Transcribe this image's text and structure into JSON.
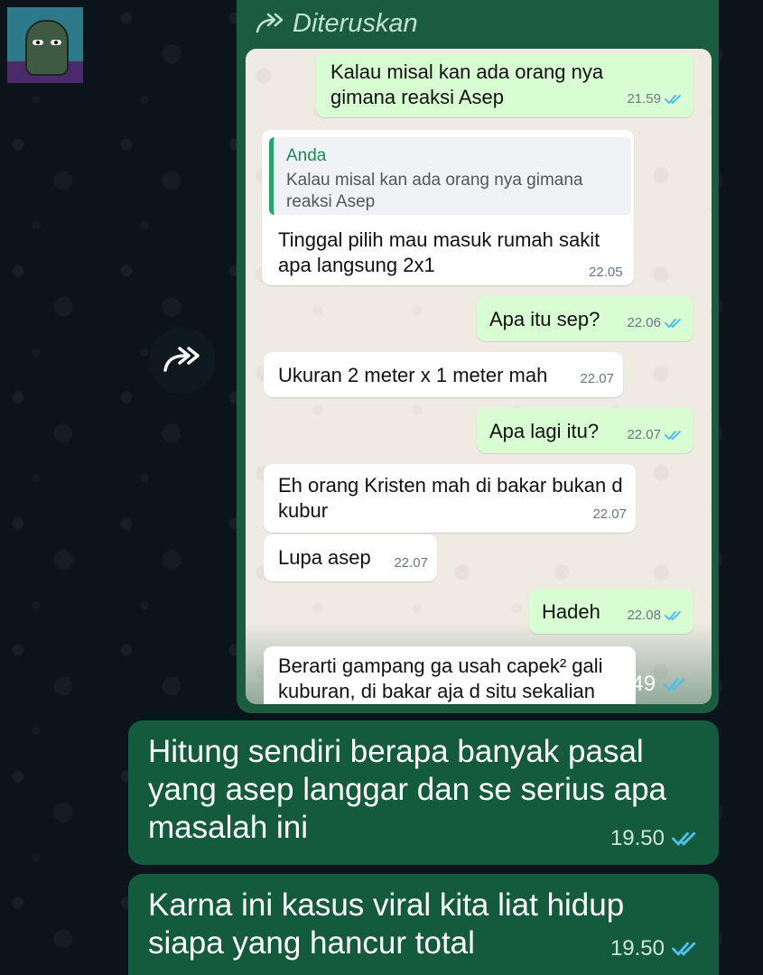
{
  "forward_label": "Diteruskan",
  "screenshot": {
    "messages": [
      {
        "text": "Kalau misal kan ada orang nya gimana reaksi Asep",
        "time": "21.59"
      },
      {
        "quote_author": "Anda",
        "quote_text": "Kalau misal kan ada orang nya gimana reaksi Asep",
        "text": "Tinggal pilih mau masuk rumah sakit apa langsung 2x1",
        "time": "22.05"
      },
      {
        "text": "Apa itu sep?",
        "time": "22.06"
      },
      {
        "text": "Ukuran 2 meter x 1 meter mah",
        "time": "22.07"
      },
      {
        "text": "Apa lagi itu?",
        "time": "22.07"
      },
      {
        "text": "Eh orang Kristen mah di bakar bukan d kubur",
        "time": "22.07"
      },
      {
        "text": "Lupa asep",
        "time": "22.07"
      },
      {
        "text": "Hadeh",
        "time": "22.08"
      },
      {
        "text": "Berarti gampang ga usah capek² gali kuburan, di bakar aja d situ sekalian",
        "time": ""
      }
    ],
    "forward_time": "19.49"
  },
  "messages": [
    {
      "text": "Hitung sendiri berapa banyak pasal yang asep langgar dan se serius apa masalah ini",
      "time": "19.50"
    },
    {
      "text": "Karna ini kasus viral kita liat hidup siapa yang hancur total",
      "time": "19.50"
    }
  ],
  "colors": {
    "background": "#0b141a",
    "outgoing_dark": "#145a3d",
    "outgoing_light": "#d9fdd3",
    "incoming_light": "#ffffff",
    "read_tick": "#53bdeb"
  }
}
